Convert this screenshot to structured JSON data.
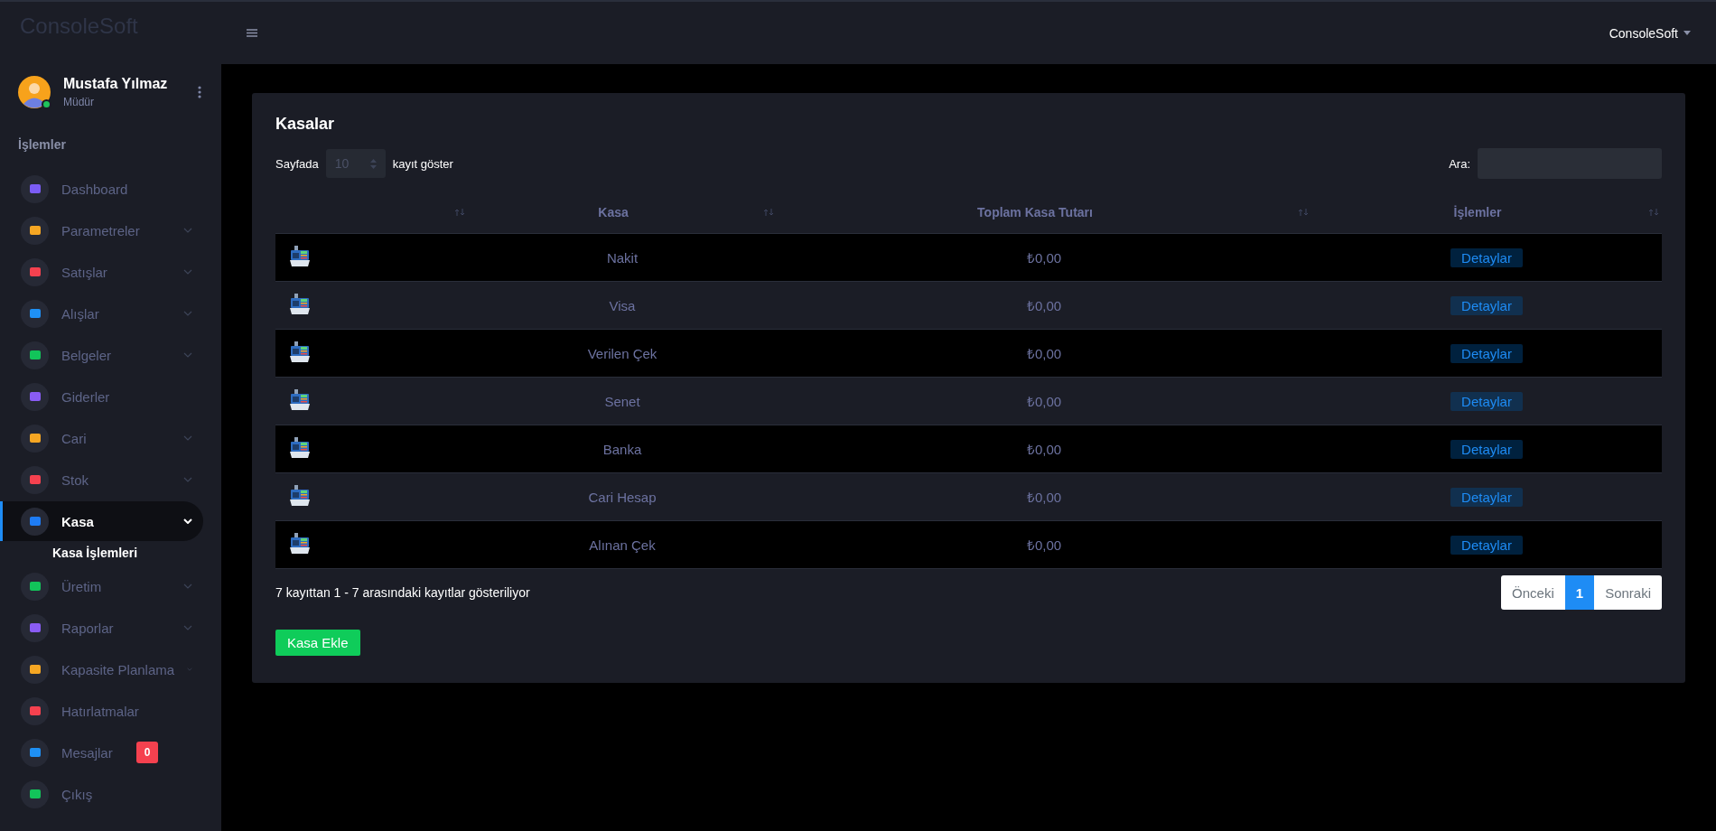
{
  "brand": "ConsoleSoft",
  "header": {
    "account": "ConsoleSoft"
  },
  "user": {
    "name": "Mustafa Yılmaz",
    "role": "Müdür",
    "online": true
  },
  "sidebar": {
    "section": "İşlemler",
    "items": [
      {
        "label": "Dashboard",
        "color": "#7b5cf5",
        "selected": false
      },
      {
        "label": "Parametreler",
        "color": "#f5a623",
        "selected": false,
        "expanded": false
      },
      {
        "label": "Satışlar",
        "color": "#f5414f",
        "selected": false,
        "expanded": false
      },
      {
        "label": "Alışlar",
        "color": "#1e90f5",
        "selected": false,
        "expanded": false
      },
      {
        "label": "Belgeler",
        "color": "#12c45a",
        "selected": false,
        "expanded": false
      },
      {
        "label": "Giderler",
        "color": "#8a5cf5",
        "selected": false
      },
      {
        "label": "Cari",
        "color": "#f5a623",
        "selected": false,
        "expanded": false
      },
      {
        "label": "Stok",
        "color": "#f5414f",
        "selected": false,
        "expanded": false
      },
      {
        "label": "Kasa",
        "color": "#1e7cf5",
        "selected": true,
        "expanded": true,
        "children": [
          {
            "label": "Kasa İşlemleri"
          }
        ]
      },
      {
        "label": "Üretim",
        "color": "#12c45a",
        "selected": false,
        "expanded": false
      },
      {
        "label": "Raporlar",
        "color": "#8a5cf5",
        "selected": false,
        "expanded": false
      },
      {
        "label": "Kapasite Planlama",
        "color": "#f5a623",
        "selected": false,
        "expanded": false
      },
      {
        "label": "Hatırlatmalar",
        "color": "#f5414f",
        "selected": false
      },
      {
        "label": "Mesajlar",
        "color": "#1e90f5",
        "selected": false,
        "badge": "0"
      },
      {
        "label": "Çıkış",
        "color": "#12c45a",
        "selected": false
      }
    ]
  },
  "card": {
    "title": "Kasalar",
    "length": {
      "before": "Sayfada",
      "value": "10",
      "after": "kayıt göster"
    },
    "search": {
      "label": "Ara:"
    },
    "table": {
      "columns": [
        "",
        "Kasa",
        "Toplam Kasa Tutarı",
        "İşlemler"
      ],
      "rows": [
        {
          "name": "Nakit",
          "total": "₺0,00",
          "action": "Detaylar"
        },
        {
          "name": "Visa",
          "total": "₺0,00",
          "action": "Detaylar"
        },
        {
          "name": "Verilen Çek",
          "total": "₺0,00",
          "action": "Detaylar"
        },
        {
          "name": "Senet",
          "total": "₺0,00",
          "action": "Detaylar"
        },
        {
          "name": "Banka",
          "total": "₺0,00",
          "action": "Detaylar"
        },
        {
          "name": "Cari Hesap",
          "total": "₺0,00",
          "action": "Detaylar"
        },
        {
          "name": "Alınan Çek",
          "total": "₺0,00",
          "action": "Detaylar"
        }
      ]
    },
    "info": "7 kayıttan 1 - 7 arasındaki kayıtlar gösteriliyor",
    "pagination": [
      {
        "label": "Önceki",
        "selected": false
      },
      {
        "label": "1",
        "selected": true
      },
      {
        "label": "Sonraki",
        "selected": false
      }
    ],
    "add_button": "Kasa Ekle"
  }
}
